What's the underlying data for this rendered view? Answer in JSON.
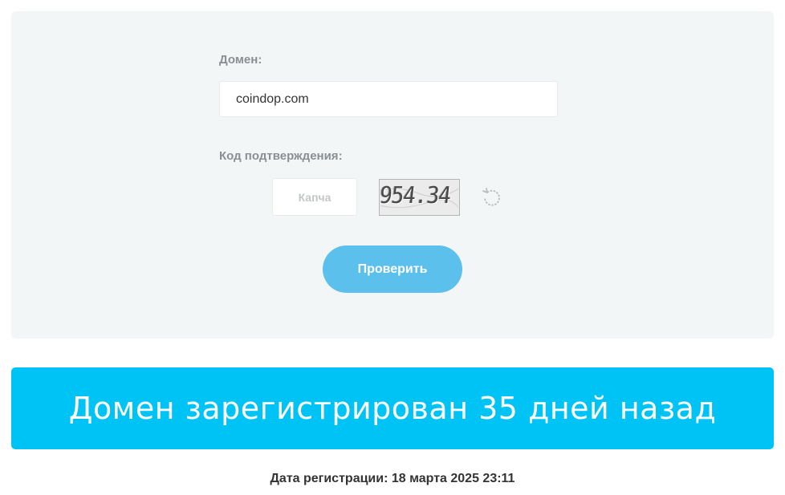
{
  "form": {
    "domain_label": "Домен:",
    "domain_value": "coindop.com",
    "code_label": "Код подтверждения:",
    "captcha_placeholder": "Капча",
    "captcha_text": "954.34",
    "submit_label": "Проверить"
  },
  "result": {
    "message": "Домен зарегистрирован 35 дней назад",
    "registration_date": "Дата регистрации: 18 марта 2025 23:11"
  },
  "colors": {
    "panel_bg": "#f3f6f7",
    "button_bg": "#5bc0eb",
    "banner_bg": "#00c3f5"
  },
  "icons": {
    "refresh": "refresh-icon"
  }
}
